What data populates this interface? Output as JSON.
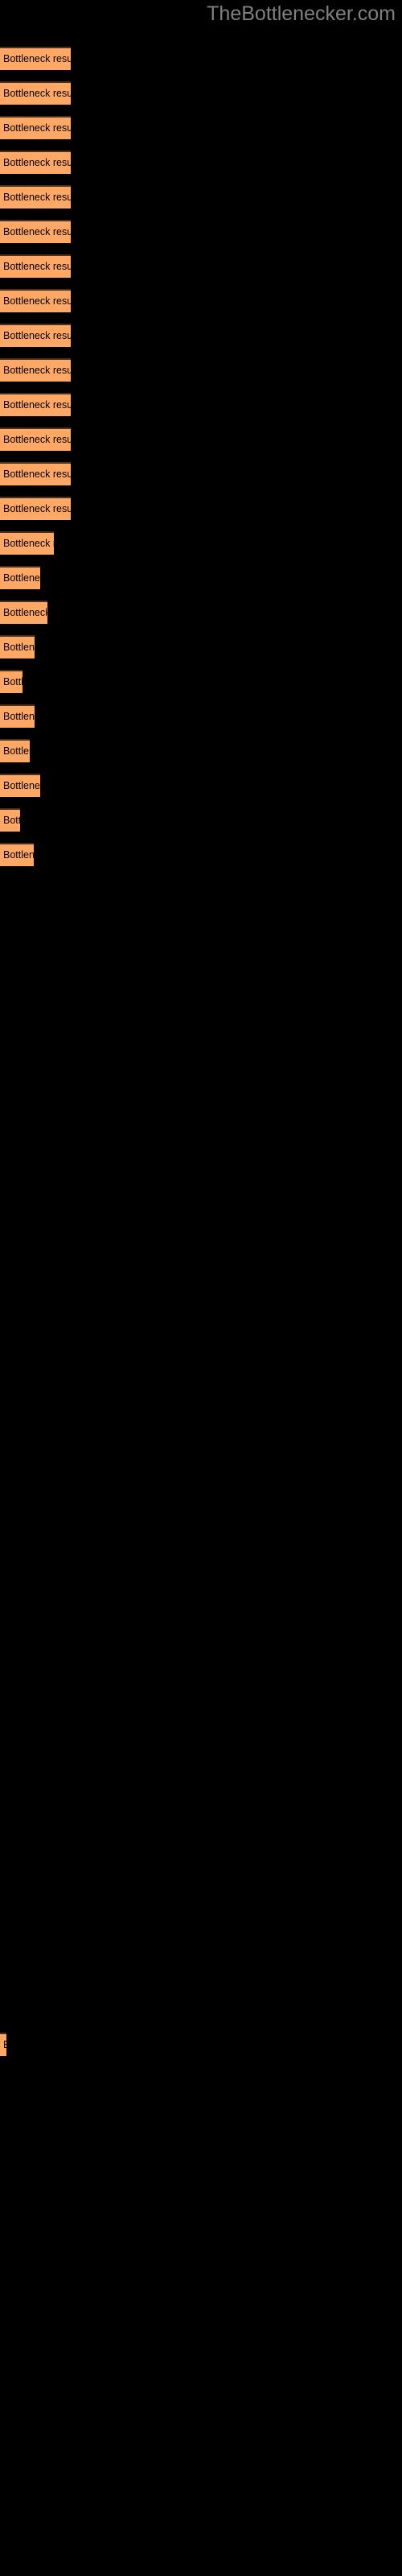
{
  "header": {
    "site_title": "TheBottlenecker.com"
  },
  "colors": {
    "background": "#000000",
    "bar_fill": "#FFA866",
    "bar_border": "#4a2f1b",
    "title_color": "#808080",
    "label_color": "#000000"
  },
  "chart_data": {
    "type": "bar",
    "orientation": "horizontal",
    "title": "",
    "xlabel": "",
    "ylabel": "",
    "grid": false,
    "legend": null,
    "bar_label_text": "Bottleneck result",
    "categories": [
      "Bottleneck result",
      "Bottleneck result",
      "Bottleneck result",
      "Bottleneck result",
      "Bottleneck result",
      "Bottleneck result",
      "Bottleneck result",
      "Bottleneck result",
      "Bottleneck result",
      "Bottleneck result",
      "Bottleneck result",
      "Bottleneck result",
      "Bottleneck result",
      "Bottleneck result",
      "Bottleneck result",
      "Bottleneck result",
      "Bottleneck result",
      "Bottleneck result",
      "Bottleneck result",
      "Bottleneck result",
      "Bottleneck result",
      "Bottleneck result",
      "Bottleneck result",
      "Bottleneck result",
      "Bottleneck result",
      "Bottleneck result"
    ],
    "values": [
      88,
      88,
      88,
      88,
      88,
      88,
      88,
      88,
      88,
      88,
      88,
      88,
      88,
      88,
      70,
      52,
      60,
      44,
      30,
      44,
      38,
      50,
      26,
      44,
      8
    ],
    "xlim": [
      0,
      500
    ],
    "bars": [
      {
        "y": 58,
        "width": 88,
        "label": "Bottleneck result"
      },
      {
        "y": 101,
        "width": 88,
        "label": "Bottleneck result"
      },
      {
        "y": 144,
        "width": 88,
        "label": "Bottleneck result"
      },
      {
        "y": 187,
        "width": 88,
        "label": "Bottleneck result"
      },
      {
        "y": 230,
        "width": 88,
        "label": "Bottleneck result"
      },
      {
        "y": 273,
        "width": 88,
        "label": "Bottleneck result"
      },
      {
        "y": 316,
        "width": 88,
        "label": "Bottleneck result"
      },
      {
        "y": 359,
        "width": 88,
        "label": "Bottleneck result"
      },
      {
        "y": 402,
        "width": 88,
        "label": "Bottleneck result"
      },
      {
        "y": 445,
        "width": 88,
        "label": "Bottleneck result"
      },
      {
        "y": 488,
        "width": 88,
        "label": "Bottleneck result"
      },
      {
        "y": 531,
        "width": 88,
        "label": "Bottleneck result"
      },
      {
        "y": 574,
        "width": 88,
        "label": "Bottleneck result"
      },
      {
        "y": 617,
        "width": 88,
        "label": "Bottleneck result"
      },
      {
        "y": 660,
        "width": 67,
        "label": "Bottleneck result"
      },
      {
        "y": 703,
        "width": 50,
        "label": "Bottleneck result"
      },
      {
        "y": 746,
        "width": 59,
        "label": "Bottleneck result"
      },
      {
        "y": 789,
        "width": 43,
        "label": "Bottleneck result"
      },
      {
        "y": 832,
        "width": 28,
        "label": "Bottleneck result"
      },
      {
        "y": 875,
        "width": 43,
        "label": "Bottleneck result"
      },
      {
        "y": 918,
        "width": 37,
        "label": "Bottleneck result"
      },
      {
        "y": 961,
        "width": 50,
        "label": "Bottleneck result"
      },
      {
        "y": 1004,
        "width": 25,
        "label": "Bottleneck result"
      },
      {
        "y": 1047,
        "width": 42,
        "label": "Bottleneck result"
      },
      {
        "y": 2525,
        "width": 8,
        "label": "Bottleneck result"
      }
    ]
  }
}
